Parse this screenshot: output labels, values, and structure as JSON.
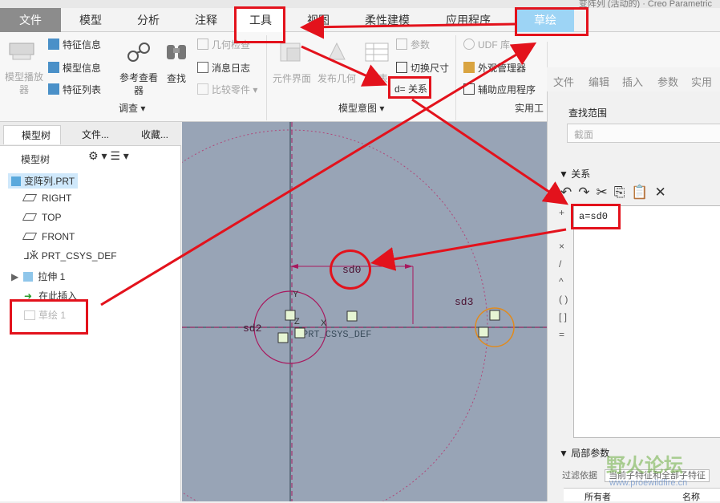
{
  "window": {
    "title_fragment": "变阵列 (活动的) · Creo Parametric"
  },
  "tabs": [
    {
      "label": "文件"
    },
    {
      "label": "模型"
    },
    {
      "label": "分析"
    },
    {
      "label": "注释"
    },
    {
      "label": "工具"
    },
    {
      "label": "视图"
    },
    {
      "label": "柔性建模"
    },
    {
      "label": "应用程序"
    },
    {
      "label": "草绘"
    }
  ],
  "ribbon": {
    "model_playback": "模型播放器",
    "feature_info": "特征信息",
    "model_info": "模型信息",
    "feature_list": "特征列表",
    "reference_viewer": "参考查看器",
    "find": "查找",
    "geometry_check": "几何检查",
    "message_log": "消息日志",
    "compare_part": "比较零件",
    "group_investigate": "调查",
    "component_interface": "元件界面",
    "publish_geometry": "发布几何",
    "family_table": "族表",
    "parameters": "参数",
    "switch_dimensions": "切换尺寸",
    "relations": "d= 关系",
    "group_model_intent": "模型意图",
    "udf_library": "UDF 库",
    "appearance_manager": "外观管理器",
    "auxiliary_apps": "辅助应用程序",
    "group_utilities": "实用工"
  },
  "relations_dialog": {
    "menu": [
      "文件",
      "编辑",
      "插入",
      "参数",
      "实用工"
    ],
    "lookin_label": "查找范围",
    "lookin_value": "截面",
    "relations_header": "关系",
    "relation_text": "a=sd0",
    "operators": [
      "+",
      "×",
      "/",
      "^",
      "( )",
      "[ ]",
      "="
    ],
    "local_params_header": "局部参数",
    "filter_label": "过滤依据",
    "filter_value": "当前子特征和全部子特征",
    "owner_col": "所有者",
    "name_col": "名称"
  },
  "model_tree": {
    "tabs": [
      "模型树",
      "文件...",
      "收藏..."
    ],
    "header": "模型树",
    "items": [
      {
        "label": "变阵列.PRT"
      },
      {
        "label": "RIGHT"
      },
      {
        "label": "TOP"
      },
      {
        "label": "FRONT"
      },
      {
        "label": "PRT_CSYS_DEF"
      },
      {
        "label": "拉伸 1"
      },
      {
        "label": "在此插入"
      },
      {
        "label": "草绘 1"
      }
    ]
  },
  "canvas": {
    "dim_sd0": "sd0",
    "dim_sd2": "sd2",
    "dim_sd3": "sd3",
    "csys_label": "PRT_CSYS_DEF",
    "y_label": "Y",
    "z_label": "Z",
    "x_label": "X"
  },
  "watermark": {
    "title": "野火论坛",
    "url": "www.proewildfire.cn"
  },
  "colors": {
    "annotation_red": "#e3121c",
    "sketch_tab": "#9dd4f5",
    "canvas_bg": "#98a4b6",
    "sketch_curve": "#a8185e"
  }
}
